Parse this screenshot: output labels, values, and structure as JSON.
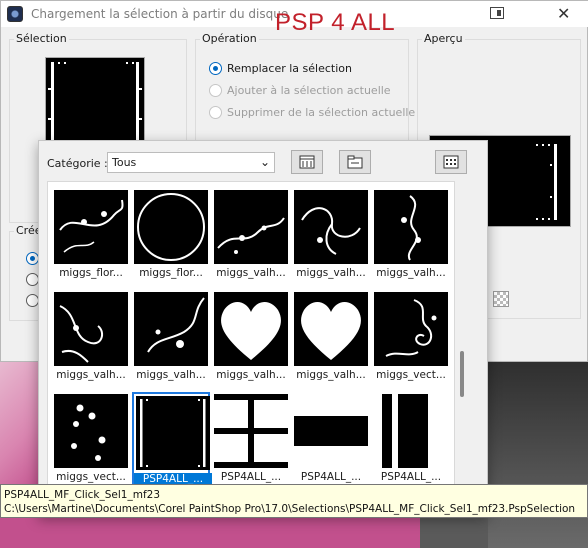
{
  "window": {
    "title": "Chargement la sélection à partir du disque",
    "brand": "PSP 4 ALL"
  },
  "selection_group": {
    "label": "Sélection"
  },
  "operation_group": {
    "label": "Opération",
    "options": [
      {
        "label": "Remplacer la sélection",
        "checked": true,
        "enabled": true
      },
      {
        "label": "Ajouter à la sélection actuelle",
        "checked": false,
        "enabled": false
      },
      {
        "label": "Supprimer de la sélection actuelle",
        "checked": false,
        "enabled": false
      }
    ]
  },
  "preview_group": {
    "label": "Aperçu"
  },
  "create_group": {
    "label": "Créer"
  },
  "picker": {
    "category_label": "Catégorie :",
    "category_value": "Tous",
    "buttons": [
      "edit-paths-icon",
      "folder-icon",
      "view-options-icon"
    ],
    "items": [
      {
        "caption": "miggs_flor...",
        "thumb": "floral-corner"
      },
      {
        "caption": "miggs_flor...",
        "thumb": "circle"
      },
      {
        "caption": "miggs_valh...",
        "thumb": "floral-bottom"
      },
      {
        "caption": "miggs_valh...",
        "thumb": "swirl"
      },
      {
        "caption": "miggs_valh...",
        "thumb": "floral-vertical"
      },
      {
        "caption": "miggs_valh...",
        "thumb": "swirl-left"
      },
      {
        "caption": "miggs_valh...",
        "thumb": "swirl-right"
      },
      {
        "caption": "miggs_valh...",
        "thumb": "heart"
      },
      {
        "caption": "miggs_valh...",
        "thumb": "heart"
      },
      {
        "caption": "miggs_vect...",
        "thumb": "vector-floral"
      },
      {
        "caption": "miggs_vect...",
        "thumb": "flowers-scattered"
      },
      {
        "caption": "PSP4ALL_...",
        "thumb": "frame-dotted",
        "selected": true
      },
      {
        "caption": "PSP4ALL_...",
        "thumb": "cross-grid"
      },
      {
        "caption": "PSP4ALL_...",
        "thumb": "horizontal-band"
      },
      {
        "caption": "PSP4ALL_...",
        "thumb": "vertical-bars"
      }
    ]
  },
  "tooltip": {
    "name": "PSP4ALL_MF_Click_Sel1_mf23",
    "path": "C:\\Users\\Martine\\Documents\\Corel PaintShop Pro\\17.0\\Selections\\PSP4ALL_MF_Click_Sel1_mf23.PspSelection"
  },
  "colors": {
    "brand": "#c2212b",
    "accent": "#0078d7"
  }
}
